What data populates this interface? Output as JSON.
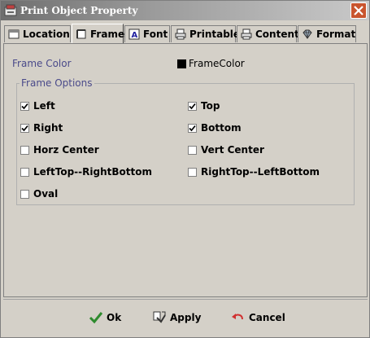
{
  "window": {
    "title": "Print Object Property"
  },
  "tabs": [
    {
      "label": "Location",
      "icon": "window-icon",
      "active": false
    },
    {
      "label": "Frame",
      "icon": "frame-icon",
      "active": true
    },
    {
      "label": "Font",
      "icon": "font-icon",
      "active": false
    },
    {
      "label": "Printable",
      "icon": "printer-icon",
      "active": false
    },
    {
      "label": "Content",
      "icon": "printer-icon",
      "active": false
    },
    {
      "label": "Format",
      "icon": "diamond-icon",
      "active": false
    }
  ],
  "frame_color": {
    "label": "Frame Color",
    "value": "FrameColor",
    "swatch": "#000000"
  },
  "frame_options": {
    "title": "Frame Options",
    "items": [
      {
        "label": "Left",
        "checked": true
      },
      {
        "label": "Top",
        "checked": true
      },
      {
        "label": "Right",
        "checked": true
      },
      {
        "label": "Bottom",
        "checked": true
      },
      {
        "label": "Horz Center",
        "checked": false
      },
      {
        "label": "Vert Center",
        "checked": false
      },
      {
        "label": "LeftTop--RightBottom",
        "checked": false
      },
      {
        "label": "RightTop--LeftBottom",
        "checked": false
      },
      {
        "label": "Oval",
        "checked": false
      }
    ]
  },
  "buttons": {
    "ok": "Ok",
    "apply": "Apply",
    "cancel": "Cancel"
  }
}
